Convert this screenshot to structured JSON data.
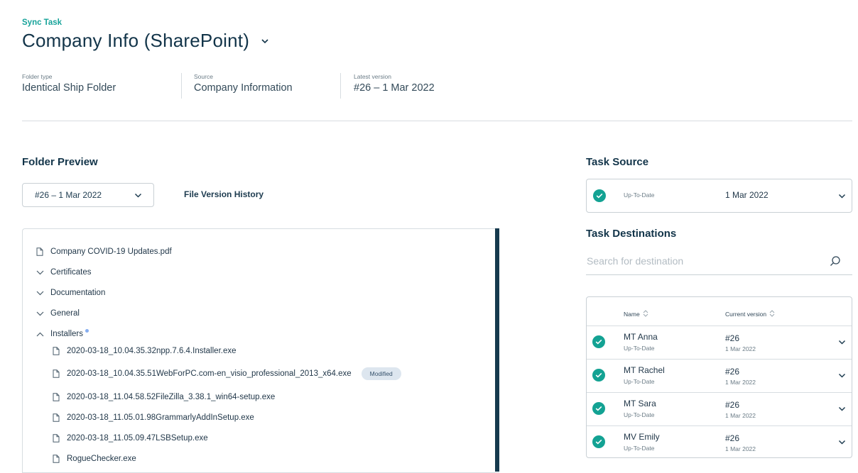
{
  "header": {
    "eyebrow": "Sync Task",
    "title": "Company Info (SharePoint)"
  },
  "meta": [
    {
      "label": "Folder type",
      "value": "Identical Ship Folder"
    },
    {
      "label": "Source",
      "value": "Company Information"
    },
    {
      "label": "Latest version",
      "value": "#26 – 1 Mar 2022"
    }
  ],
  "folder_preview": {
    "title": "Folder Preview",
    "version_select": "#26 – 1 Mar 2022",
    "history_link": "File Version History",
    "tree": [
      {
        "type": "file",
        "name": "Company COVID-19 Updates.pdf",
        "indent": 0
      },
      {
        "type": "folder",
        "name": "Certificates",
        "expanded": false,
        "indent": 0
      },
      {
        "type": "folder",
        "name": "Documentation",
        "expanded": false,
        "indent": 0
      },
      {
        "type": "folder",
        "name": "General",
        "expanded": false,
        "indent": 0
      },
      {
        "type": "folder",
        "name": "Installers",
        "expanded": true,
        "indent": 0,
        "has_dot": true
      },
      {
        "type": "file",
        "name": "2020-03-18_10.04.35.32npp.7.6.4.Installer.exe",
        "indent": 1
      },
      {
        "type": "file",
        "name": "2020-03-18_10.04.35.51WebForPC.com-en_visio_professional_2013_x64.exe",
        "indent": 1,
        "badge": "Modified"
      },
      {
        "type": "file",
        "name": "2020-03-18_11.04.58.52FileZilla_3.38.1_win64-setup.exe",
        "indent": 1
      },
      {
        "type": "file",
        "name": "2020-03-18_11.05.01.98GrammarlyAddInSetup.exe",
        "indent": 1
      },
      {
        "type": "file",
        "name": "2020-03-18_11.05.09.47LSBSetup.exe",
        "indent": 1
      },
      {
        "type": "file",
        "name": "RogueChecker.exe",
        "indent": 1
      }
    ]
  },
  "task_source": {
    "title": "Task Source",
    "status": "Up-To-Date",
    "date": "1 Mar 2022"
  },
  "task_destinations": {
    "title": "Task Destinations",
    "search_placeholder": "Search for destination",
    "columns": {
      "name": "Name",
      "version": "Current version"
    },
    "rows": [
      {
        "name": "MT Anna",
        "status": "Up-To-Date",
        "version": "#26",
        "date": "1 Mar 2022"
      },
      {
        "name": "MT Rachel",
        "status": "Up-To-Date",
        "version": "#26",
        "date": "1 Mar 2022"
      },
      {
        "name": "MT Sara",
        "status": "Up-To-Date",
        "version": "#26",
        "date": "1 Mar 2022"
      },
      {
        "name": "MV Emily",
        "status": "Up-To-Date",
        "version": "#26",
        "date": "1 Mar 2022"
      }
    ]
  },
  "colors": {
    "accent": "#17a39a",
    "status_ok": "#13a293",
    "text_dark": "#123449",
    "scrollbar": "#163a4e"
  }
}
